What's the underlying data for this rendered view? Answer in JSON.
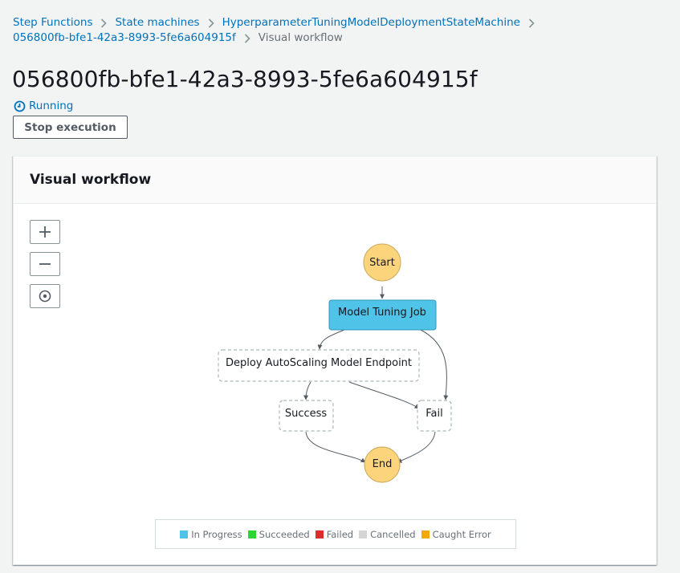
{
  "breadcrumb": {
    "items": [
      "Step Functions",
      "State machines",
      "HyperparameterTuningModelDeploymentStateMachine",
      "056800fb-bfe1-42a3-8993-5fe6a604915f"
    ],
    "current": "Visual workflow"
  },
  "page": {
    "title": "056800fb-bfe1-42a3-8993-5fe6a604915f",
    "status": "Running",
    "stop_label": "Stop execution"
  },
  "panel": {
    "title": "Visual workflow"
  },
  "workflow": {
    "nodes": {
      "start": "Start",
      "tuning": "Model Tuning Job",
      "deploy": "Deploy AutoScaling Model Endpoint",
      "success": "Success",
      "fail": "Fail",
      "end": "End"
    }
  },
  "legend": [
    {
      "label": "In Progress",
      "color": "#4fc3e8"
    },
    {
      "label": "Succeeded",
      "color": "#2bd62e"
    },
    {
      "label": "Failed",
      "color": "#e02b2b"
    },
    {
      "label": "Cancelled",
      "color": "#d5d5d5"
    },
    {
      "label": "Caught Error",
      "color": "#f7a70a"
    }
  ],
  "colors": {
    "link": "#0073bb",
    "in_progress_fill": "#4fc3e8",
    "start_end_fill": "#fcd47c"
  }
}
